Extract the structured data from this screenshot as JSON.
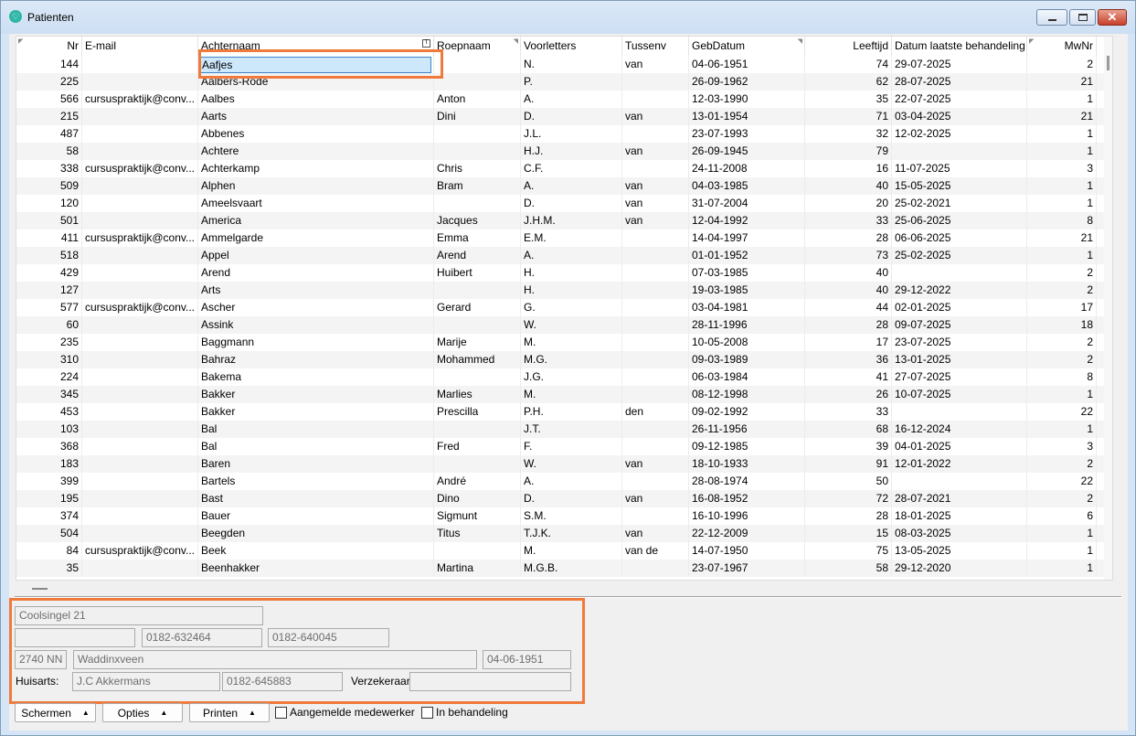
{
  "window": {
    "title": "Patienten",
    "close_glyph": "✕",
    "app_icon_glyph": "♡"
  },
  "grid": {
    "columns": {
      "nr": "Nr",
      "email": "E-mail",
      "achternaam": "Achternaam",
      "roepnaam": "Roepnaam",
      "voorletters": "Voorletters",
      "tussenv": "Tussenv",
      "gebdatum": "GebDatum",
      "leeftijd": "Leeftijd",
      "datum_laatste": "Datum laatste behandeling",
      "mwnr": "MwNr"
    },
    "filter_icon": "T",
    "rows": [
      [
        "144",
        "",
        "Aafjes",
        "",
        "N.",
        "van",
        "04-06-1951",
        "74",
        "29-07-2025",
        "2"
      ],
      [
        "225",
        "",
        "Aalbers-Rode",
        "",
        "P.",
        "",
        "26-09-1962",
        "62",
        "28-07-2025",
        "21"
      ],
      [
        "566",
        "cursuspraktijk@conv...",
        "Aalbes",
        "Anton",
        "A.",
        "",
        "12-03-1990",
        "35",
        "22-07-2025",
        "1"
      ],
      [
        "215",
        "",
        "Aarts",
        "Dini",
        "D.",
        "van",
        "13-01-1954",
        "71",
        "03-04-2025",
        "21"
      ],
      [
        "487",
        "",
        "Abbenes",
        "",
        "J.L.",
        "",
        "23-07-1993",
        "32",
        "12-02-2025",
        "1"
      ],
      [
        "58",
        "",
        "Achtere",
        "",
        "H.J.",
        "van",
        "26-09-1945",
        "79",
        "",
        "1"
      ],
      [
        "338",
        "cursuspraktijk@conv...",
        "Achterkamp",
        "Chris",
        "C.F.",
        "",
        "24-11-2008",
        "16",
        "11-07-2025",
        "3"
      ],
      [
        "509",
        "",
        "Alphen",
        "Bram",
        "A.",
        "van",
        "04-03-1985",
        "40",
        "15-05-2025",
        "1"
      ],
      [
        "120",
        "",
        "Ameelsvaart",
        "",
        "D.",
        "van",
        "31-07-2004",
        "20",
        "25-02-2021",
        "1"
      ],
      [
        "501",
        "",
        "America",
        "Jacques",
        "J.H.M.",
        "van",
        "12-04-1992",
        "33",
        "25-06-2025",
        "8"
      ],
      [
        "411",
        "cursuspraktijk@conv...",
        "Ammelgarde",
        "Emma",
        "E.M.",
        "",
        "14-04-1997",
        "28",
        "06-06-2025",
        "21"
      ],
      [
        "518",
        "",
        "Appel",
        "Arend",
        "A.",
        "",
        "01-01-1952",
        "73",
        "25-02-2025",
        "1"
      ],
      [
        "429",
        "",
        "Arend",
        "Huibert",
        "H.",
        "",
        "07-03-1985",
        "40",
        "",
        "2"
      ],
      [
        "127",
        "",
        "Arts",
        "",
        "H.",
        "",
        "19-03-1985",
        "40",
        "29-12-2022",
        "2"
      ],
      [
        "577",
        "cursuspraktijk@conv...",
        "Ascher",
        "Gerard",
        "G.",
        "",
        "03-04-1981",
        "44",
        "02-01-2025",
        "17"
      ],
      [
        "60",
        "",
        "Assink",
        "",
        "W.",
        "",
        "28-11-1996",
        "28",
        "09-07-2025",
        "18"
      ],
      [
        "235",
        "",
        "Baggmann",
        "Marije",
        "M.",
        "",
        "10-05-2008",
        "17",
        "23-07-2025",
        "2"
      ],
      [
        "310",
        "",
        "Bahraz",
        "Mohammed",
        "M.G.",
        "",
        "09-03-1989",
        "36",
        "13-01-2025",
        "2"
      ],
      [
        "224",
        "",
        "Bakema",
        "",
        "J.G.",
        "",
        "06-03-1984",
        "41",
        "27-07-2025",
        "8"
      ],
      [
        "345",
        "",
        "Bakker",
        "Marlies",
        "M.",
        "",
        "08-12-1998",
        "26",
        "10-07-2025",
        "1"
      ],
      [
        "453",
        "",
        "Bakker",
        "Prescilla",
        "P.H.",
        "den",
        "09-02-1992",
        "33",
        "",
        "22"
      ],
      [
        "103",
        "",
        "Bal",
        "",
        "J.T.",
        "",
        "26-11-1956",
        "68",
        "16-12-2024",
        "1"
      ],
      [
        "368",
        "",
        "Bal",
        "Fred",
        "F.",
        "",
        "09-12-1985",
        "39",
        "04-01-2025",
        "3"
      ],
      [
        "183",
        "",
        "Baren",
        "",
        "W.",
        "van",
        "18-10-1933",
        "91",
        "12-01-2022",
        "2"
      ],
      [
        "399",
        "",
        "Bartels",
        "André",
        "A.",
        "",
        "28-08-1974",
        "50",
        "",
        "22"
      ],
      [
        "195",
        "",
        "Bast",
        "Dino",
        "D.",
        "van",
        "16-08-1952",
        "72",
        "28-07-2021",
        "2"
      ],
      [
        "374",
        "",
        "Bauer",
        "Sigmunt",
        "S.M.",
        "",
        "16-10-1996",
        "28",
        "18-01-2025",
        "6"
      ],
      [
        "504",
        "",
        "Beegden",
        "Titus",
        "T.J.K.",
        "van",
        "22-12-2009",
        "15",
        "08-03-2025",
        "1"
      ],
      [
        "84",
        "cursuspraktijk@conv...",
        "Beek",
        "",
        "M.",
        "van de",
        "14-07-1950",
        "75",
        "13-05-2025",
        "1"
      ],
      [
        "35",
        "",
        "Beenhakker",
        "Martina",
        "M.G.B.",
        "",
        "23-07-1967",
        "58",
        "29-12-2020",
        "1"
      ]
    ]
  },
  "details": {
    "address": "Coolsingel 21",
    "phone_empty": "",
    "phone1": "0182-632464",
    "phone2": "0182-640045",
    "postcode": "2740 NN",
    "city": "Waddinxveen",
    "birthdate": "04-06-1951",
    "huisarts_label": "Huisarts:",
    "huisarts": "J.C Akkermans",
    "huisarts_phone": "0182-645883",
    "verzekeraar_label": "Verzekeraar:",
    "verzekeraar": ""
  },
  "toolbar": {
    "schermen": "Schermen",
    "opties": "Opties",
    "printen": "Printen",
    "arrow_glyph": "▲",
    "aangemelde_medewerker": "Aangemelde medewerker",
    "in_behandeling": "In behandeling"
  },
  "colors": {
    "highlight": "#f07a3c",
    "selected_cell_bg": "#cde8fb",
    "window_bg": "#d6e5f5"
  }
}
